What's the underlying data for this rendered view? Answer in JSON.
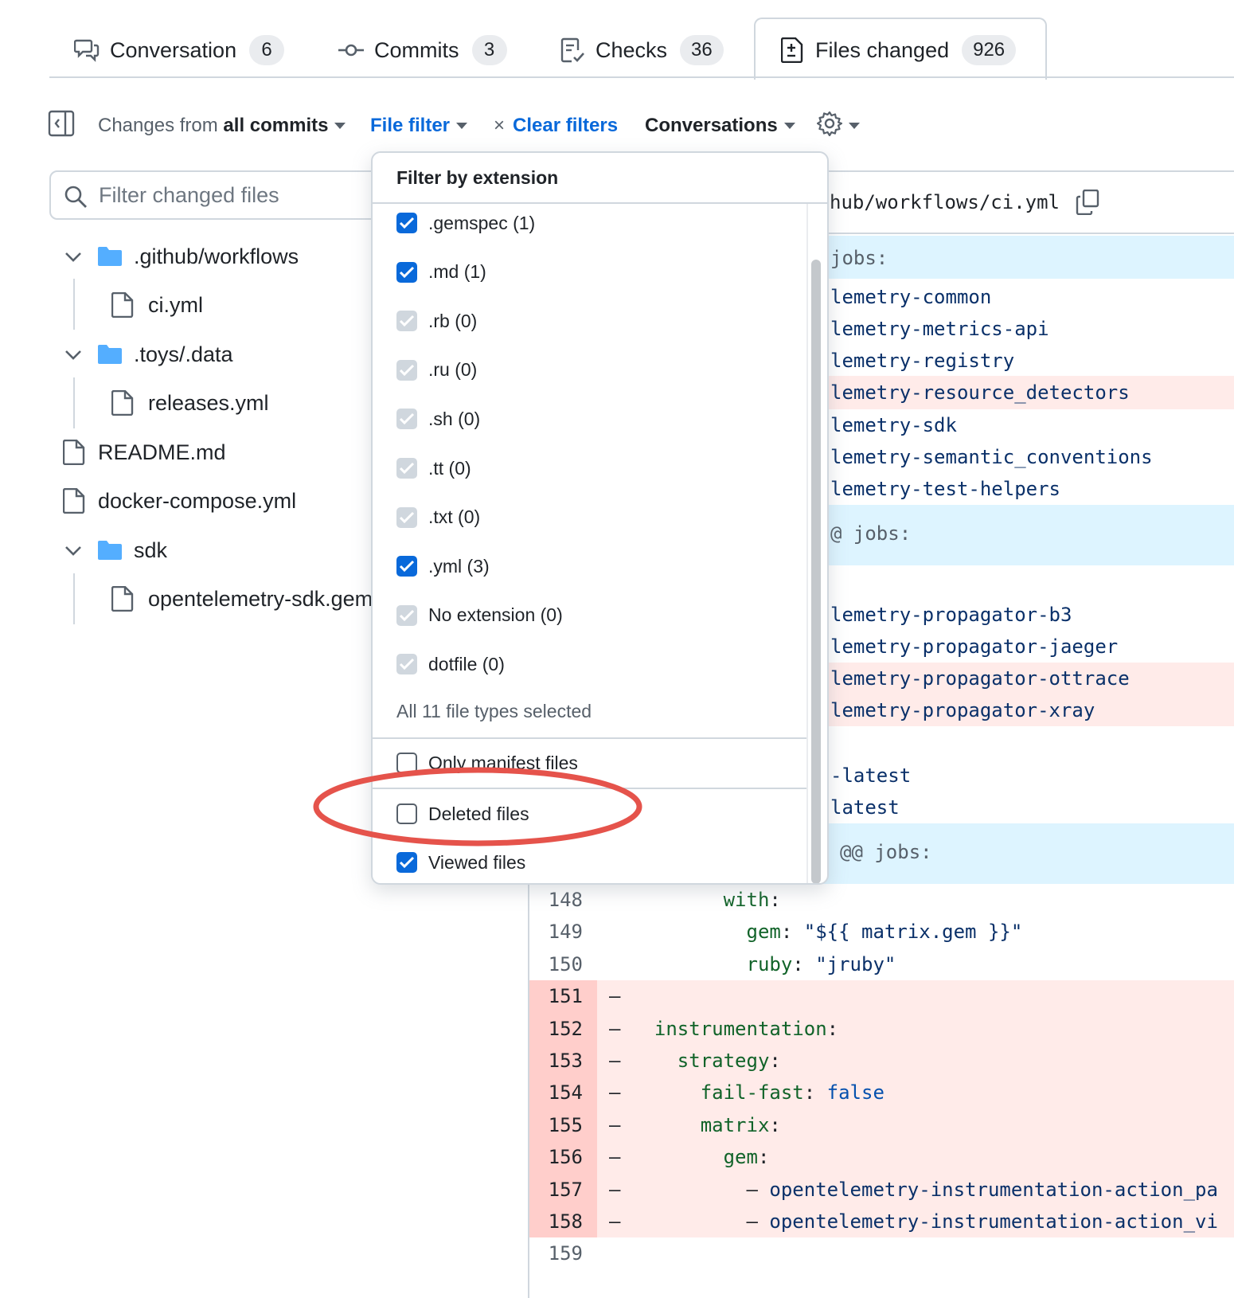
{
  "tabs": [
    {
      "label": "Conversation",
      "count": "6",
      "icon": "comment-discussion-icon"
    },
    {
      "label": "Commits",
      "count": "3",
      "icon": "git-commit-icon"
    },
    {
      "label": "Checks",
      "count": "36",
      "icon": "checklist-icon"
    },
    {
      "label": "Files changed",
      "count": "926",
      "icon": "file-diff-icon"
    }
  ],
  "toolbar": {
    "changes_prefix": "Changes from",
    "changes_value": "all commits",
    "file_filter": "File filter",
    "clear_filters": "Clear filters",
    "conversations": "Conversations"
  },
  "search": {
    "placeholder": "Filter changed files"
  },
  "tree": [
    {
      "label": ".github/workflows",
      "type": "folder"
    },
    {
      "label": "ci.yml",
      "type": "file"
    },
    {
      "label": ".toys/.data",
      "type": "folder"
    },
    {
      "label": "releases.yml",
      "type": "file"
    },
    {
      "label": "README.md",
      "type": "file"
    },
    {
      "label": "docker-compose.yml",
      "type": "file"
    },
    {
      "label": "sdk",
      "type": "folder"
    },
    {
      "label": "opentelemetry-sdk.gemspec",
      "type": "file"
    }
  ],
  "code_header": {
    "path": "hub/workflows/ci.yml"
  },
  "code_lines": [
    {
      "kind": "hunk",
      "num": "",
      "text": "jobs:"
    },
    {
      "kind": "ctx",
      "num": "",
      "text": "lemetry-common"
    },
    {
      "kind": "ctx",
      "num": "",
      "text": "lemetry-metrics-api"
    },
    {
      "kind": "ctx",
      "num": "",
      "text": "lemetry-registry"
    },
    {
      "kind": "delsoft",
      "num": "",
      "text": "lemetry-resource_detectors"
    },
    {
      "kind": "ctx",
      "num": "",
      "text": "lemetry-sdk"
    },
    {
      "kind": "ctx",
      "num": "",
      "text": "lemetry-semantic_conventions"
    },
    {
      "kind": "ctx",
      "num": "",
      "text": "lemetry-test-helpers"
    },
    {
      "kind": "hunk",
      "num": "",
      "text": "@ jobs:"
    },
    {
      "kind": "ctx",
      "num": "",
      "text": "lemetry-propagator-b3"
    },
    {
      "kind": "ctx",
      "num": "",
      "text": "lemetry-propagator-jaeger"
    },
    {
      "kind": "delsoft",
      "num": "",
      "text": "lemetry-propagator-ottrace"
    },
    {
      "kind": "delsoft",
      "num": "",
      "text": "lemetry-propagator-xray"
    },
    {
      "kind": "ctx",
      "num": "",
      "text": "-latest"
    },
    {
      "kind": "ctx",
      "num": "",
      "text": "latest"
    },
    {
      "kind": "hunk",
      "num": "",
      "text": "@@ jobs:"
    }
  ],
  "numbered_lines": [
    {
      "num": "148",
      "sign": "",
      "indent": "        ",
      "key": "with",
      "rest": ":",
      "val": ""
    },
    {
      "num": "149",
      "sign": "",
      "indent": "          ",
      "key": "gem",
      "rest": ": ",
      "val": "\"${{ matrix.gem }}\""
    },
    {
      "num": "150",
      "sign": "",
      "indent": "          ",
      "key": "ruby",
      "rest": ": ",
      "val": "\"jruby\""
    },
    {
      "num": "151",
      "sign": "–",
      "indent": "",
      "key": "",
      "rest": "",
      "val": ""
    },
    {
      "num": "152",
      "sign": "–",
      "indent": "  ",
      "key": "instrumentation",
      "rest": ":",
      "val": ""
    },
    {
      "num": "153",
      "sign": "–",
      "indent": "    ",
      "key": "strategy",
      "rest": ":",
      "val": ""
    },
    {
      "num": "154",
      "sign": "–",
      "indent": "      ",
      "key": "fail-fast",
      "rest": ": ",
      "val": "false"
    },
    {
      "num": "155",
      "sign": "–",
      "indent": "      ",
      "key": "matrix",
      "rest": ":",
      "val": ""
    },
    {
      "num": "156",
      "sign": "–",
      "indent": "        ",
      "key": "gem",
      "rest": ":",
      "val": ""
    },
    {
      "num": "157",
      "sign": "–",
      "indent": "          ",
      "key": "",
      "rest": "– ",
      "val": "opentelemetry-instrumentation-action_pa"
    },
    {
      "num": "158",
      "sign": "–",
      "indent": "          ",
      "key": "",
      "rest": "– ",
      "val": "opentelemetry-instrumentation-action_vi"
    },
    {
      "num": "159",
      "sign": "",
      "indent": "",
      "key": "",
      "rest": "",
      "val": ""
    }
  ],
  "dropdown": {
    "title": "Filter by extension",
    "options": [
      {
        "label": ".gemspec (1)",
        "state": "on"
      },
      {
        "label": ".md (1)",
        "state": "on"
      },
      {
        "label": ".rb (0)",
        "state": "dis"
      },
      {
        "label": ".ru (0)",
        "state": "dis"
      },
      {
        "label": ".sh (0)",
        "state": "dis"
      },
      {
        "label": ".tt (0)",
        "state": "dis"
      },
      {
        "label": ".txt (0)",
        "state": "dis"
      },
      {
        "label": ".yml (3)",
        "state": "on"
      },
      {
        "label": "No extension (0)",
        "state": "dis"
      },
      {
        "label": "dotfile (0)",
        "state": "dis"
      }
    ],
    "summary": "All 11 file types selected",
    "manifest": "Only manifest files",
    "deleted": "Deleted files",
    "viewed": "Viewed files"
  },
  "colors": {
    "accent": "#0969da",
    "highlight_ring": "#e5534b",
    "deleted_bg": "#ffebe9",
    "hunk_bg": "#ddf4ff"
  }
}
